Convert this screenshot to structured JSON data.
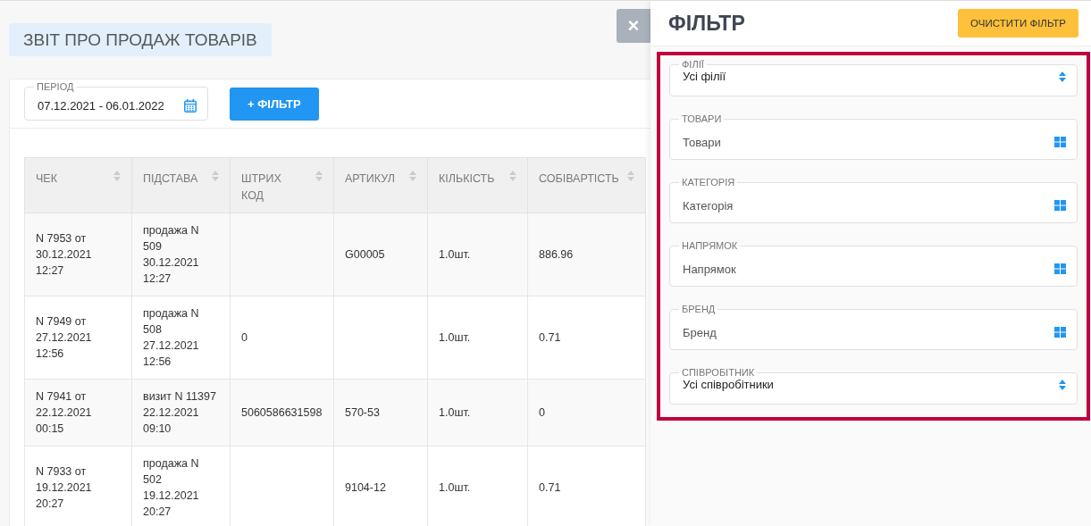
{
  "page_title": "ЗВІТ ПРО ПРОДАЖ ТОВАРІВ",
  "period": {
    "label": "ПЕРІОД",
    "value": "07.12.2021 - 06.01.2022"
  },
  "add_filter_button": "+ ФІЛЬТР",
  "table": {
    "columns": [
      "ЧЕК",
      "ПІДСТАВА",
      "ШТРИХ\nКОД",
      "АРТИКУЛ",
      "КІЛЬКІСТЬ",
      "СОБІВАРТІСТЬ"
    ],
    "rows": [
      {
        "cells": [
          "N 7953 от\n30.12.2021 12:27",
          "продажа N\n509\n30.12.2021\n12:27",
          "",
          "G00005",
          "1.0шт.",
          "886.96"
        ]
      },
      {
        "cells": [
          "N 7949 от\n27.12.2021 12:56",
          "продажа N\n508\n27.12.2021\n12:56",
          "0",
          "",
          "1.0шт.",
          "0.71"
        ]
      },
      {
        "cells": [
          "N 7941 от\n22.12.2021 00:15",
          "визит N 11397\n22.12.2021\n09:10",
          "5060586631598",
          "570-53",
          "1.0шт.",
          "0"
        ]
      },
      {
        "cells": [
          "N 7933 от\n19.12.2021 20:27",
          "продажа N\n502\n19.12.2021\n20:27",
          "",
          "9104-12",
          "1.0шт.",
          "0.71"
        ]
      }
    ]
  },
  "close_button": "×",
  "drawer": {
    "title": "ФІЛЬТР",
    "clear_button": "ОЧИСТИТИ ФІЛЬТР",
    "fields": [
      {
        "kind": "select",
        "label": "ФІЛІЇ",
        "value": "Усі філії"
      },
      {
        "kind": "picker",
        "label": "ТОВАРИ",
        "value": "Товари"
      },
      {
        "kind": "picker",
        "label": "КАТЕГОРІЯ",
        "value": "Категорія"
      },
      {
        "kind": "picker",
        "label": "НАПРЯМОК",
        "value": "Напрямок"
      },
      {
        "kind": "picker",
        "label": "БРЕНД",
        "value": "Бренд"
      },
      {
        "kind": "select",
        "label": "СПІВРОБІТНИК",
        "value": "Усі співробітники"
      }
    ]
  }
}
